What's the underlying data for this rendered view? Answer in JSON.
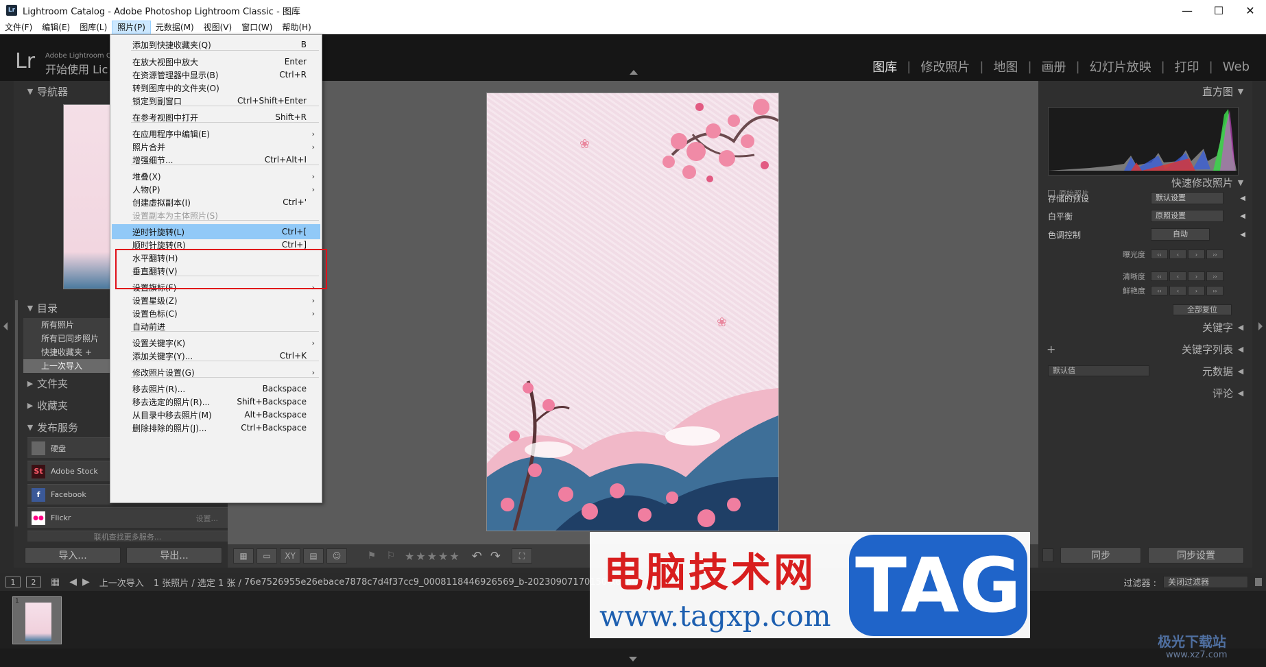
{
  "window": {
    "title": "Lightroom Catalog - Adobe Photoshop Lightroom Classic - 图库",
    "badge": "Lr",
    "minimize": "—",
    "maximize": "☐",
    "close": "✕"
  },
  "menubar": [
    "文件(F)",
    "编辑(E)",
    "图库(L)",
    "照片(P)",
    "元数据(M)",
    "视图(V)",
    "窗口(W)",
    "帮助(H)"
  ],
  "identity": {
    "logo": "Lr",
    "line1": "Adobe Lightroom Cl",
    "line2": "开始使用 Lic"
  },
  "modules": [
    "图库",
    "修改照片",
    "地图",
    "画册",
    "幻灯片放映",
    "打印",
    "Web"
  ],
  "left_panel": {
    "navigator": "导航器",
    "catalog": "目录",
    "catalog_items": [
      "所有照片",
      "所有已同步照片",
      "快捷收藏夹 +",
      "上一次导入"
    ],
    "folders": "文件夹",
    "collections": "收藏夹",
    "publish": "发布服务",
    "publish_items": [
      {
        "icon": "",
        "label": "硬盘",
        "setting": ""
      },
      {
        "icon": "St",
        "label": "Adobe Stock",
        "setting": ""
      },
      {
        "icon": "f",
        "label": "Facebook",
        "setting": ""
      },
      {
        "icon": "●●",
        "label": "Flickr",
        "setting": "设置..."
      }
    ],
    "more_services": "联机查找更多服务...",
    "import_button": "导入...",
    "export_button": "导出..."
  },
  "photo_menu": {
    "items": [
      {
        "label": "添加到快捷收藏夹(Q)",
        "shortcut": "B",
        "submenu": false,
        "disabled": false
      },
      {
        "label": "在放大视图中放大",
        "shortcut": "Enter",
        "submenu": false,
        "disabled": false
      },
      {
        "label": "在资源管理器中显示(B)",
        "shortcut": "Ctrl+R",
        "submenu": false,
        "disabled": false
      },
      {
        "label": "转到图库中的文件夹(O)",
        "shortcut": "",
        "submenu": false,
        "disabled": false
      },
      {
        "label": "锁定到副窗口",
        "shortcut": "Ctrl+Shift+Enter",
        "submenu": false,
        "disabled": false
      },
      {
        "label": "在参考视图中打开",
        "shortcut": "Shift+R",
        "submenu": false,
        "disabled": false
      },
      {
        "label": "在应用程序中编辑(E)",
        "shortcut": "",
        "submenu": true,
        "disabled": false
      },
      {
        "label": "照片合并",
        "shortcut": "",
        "submenu": true,
        "disabled": false
      },
      {
        "label": "增强细节...",
        "shortcut": "Ctrl+Alt+I",
        "submenu": false,
        "disabled": false
      },
      {
        "label": "堆叠(X)",
        "shortcut": "",
        "submenu": true,
        "disabled": false
      },
      {
        "label": "人物(P)",
        "shortcut": "",
        "submenu": true,
        "disabled": false
      },
      {
        "label": "创建虚拟副本(I)",
        "shortcut": "Ctrl+'",
        "submenu": false,
        "disabled": false
      },
      {
        "label": "设置副本为主体照片(S)",
        "shortcut": "",
        "submenu": false,
        "disabled": true
      },
      {
        "label": "逆时针旋转(L)",
        "shortcut": "Ctrl+[",
        "submenu": false,
        "disabled": false
      },
      {
        "label": "顺时针旋转(R)",
        "shortcut": "Ctrl+]",
        "submenu": false,
        "disabled": false
      },
      {
        "label": "水平翻转(H)",
        "shortcut": "",
        "submenu": false,
        "disabled": false
      },
      {
        "label": "垂直翻转(V)",
        "shortcut": "",
        "submenu": false,
        "disabled": false
      },
      {
        "label": "设置旗标(F)",
        "shortcut": "",
        "submenu": true,
        "disabled": false
      },
      {
        "label": "设置星级(Z)",
        "shortcut": "",
        "submenu": true,
        "disabled": false
      },
      {
        "label": "设置色标(C)",
        "shortcut": "",
        "submenu": true,
        "disabled": false
      },
      {
        "label": "自动前进",
        "shortcut": "",
        "submenu": false,
        "disabled": false
      },
      {
        "label": "设置关键字(K)",
        "shortcut": "",
        "submenu": true,
        "disabled": false
      },
      {
        "label": "添加关键字(Y)...",
        "shortcut": "Ctrl+K",
        "submenu": false,
        "disabled": false
      },
      {
        "label": "修改照片设置(G)",
        "shortcut": "",
        "submenu": true,
        "disabled": false
      },
      {
        "label": "移去照片(R)...",
        "shortcut": "Backspace",
        "submenu": false,
        "disabled": false
      },
      {
        "label": "移去选定的照片(R)...",
        "shortcut": "Shift+Backspace",
        "submenu": false,
        "disabled": false
      },
      {
        "label": "从目录中移去照片(M)",
        "shortcut": "Alt+Backspace",
        "submenu": false,
        "disabled": false
      },
      {
        "label": "删除排除的照片(J)...",
        "shortcut": "Ctrl+Backspace",
        "submenu": false,
        "disabled": false
      }
    ]
  },
  "right_panel": {
    "histogram": "直方图",
    "original_photo": "原始照片",
    "quick_develop": "快速修改照片",
    "saved_preset_label": "存储的预设",
    "saved_preset_value": "默认设置",
    "white_balance_label": "白平衡",
    "white_balance_value": "原照设置",
    "tone_control_label": "色调控制",
    "auto_button": "自动",
    "sliders": [
      "曝光度",
      "清晰度",
      "鲜艳度"
    ],
    "slider_buttons": [
      "‹‹",
      "‹",
      "›",
      "››"
    ],
    "reset_all": "全部复位",
    "keywording": "关键字",
    "keyword_list": "关键字列表",
    "plus": "+",
    "metadata_select": "默认值",
    "metadata": "元数据",
    "comments": "评论",
    "sync_button": "同步",
    "sync_settings_button": "同步设置"
  },
  "toolbar": {
    "grid": "▦",
    "loupe": "▭",
    "compare": "XY",
    "survey": "▤",
    "people": "☺",
    "stars": "★★★★★",
    "rotate_ccw": "↶",
    "rotate_cw": "↷",
    "crop": "⛶"
  },
  "filmstrip_bar": {
    "screen1": "1",
    "screen2": "2",
    "source": "上一次导入",
    "count": "1 张照片 / 选定 1 张 /",
    "filename": "76e7526955e26ebace7878c7d4f37cc9_0008118446926569_b-20230907170150-x6cpn94.jpg",
    "filter_label": "过滤器 :",
    "filter_value": "关闭过滤器"
  },
  "filmstrip": {
    "index": "1"
  },
  "watermark": {
    "cn": "电脑技术网",
    "url": "www.tagxp.com",
    "tag": "TAG",
    "site2": "极光下载站",
    "site2_url": "www.xz7.com"
  },
  "colors": {
    "accent_highlight": "#91c9f7",
    "callout_red": "#e0101a",
    "menu_active": "#cce8ff"
  }
}
